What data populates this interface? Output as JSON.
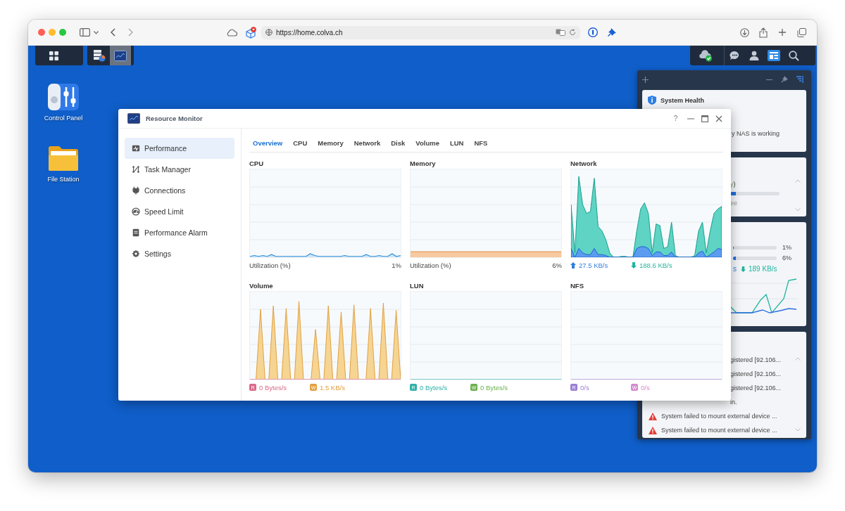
{
  "browser": {
    "url": "https://home.colva.ch"
  },
  "taskbar": {
    "apps": [
      {
        "selected": false
      },
      {
        "selected": true
      }
    ]
  },
  "desktop_icons": [
    {
      "label": "Control Panel"
    },
    {
      "label": "File Station"
    }
  ],
  "window": {
    "title": "Resource Monitor",
    "help": "?"
  },
  "sidebar": {
    "items": [
      {
        "label": "Performance",
        "selected": true
      },
      {
        "label": "Task Manager",
        "selected": false
      },
      {
        "label": "Connections",
        "selected": false
      },
      {
        "label": "Speed Limit",
        "selected": false
      },
      {
        "label": "Performance Alarm",
        "selected": false
      },
      {
        "label": "Settings",
        "selected": false
      }
    ]
  },
  "tabs": [
    {
      "label": "Overview",
      "selected": true
    },
    {
      "label": "CPU",
      "selected": false
    },
    {
      "label": "Memory",
      "selected": false
    },
    {
      "label": "Network",
      "selected": false
    },
    {
      "label": "Disk",
      "selected": false
    },
    {
      "label": "Volume",
      "selected": false
    },
    {
      "label": "LUN",
      "selected": false
    },
    {
      "label": "NFS",
      "selected": false
    }
  ],
  "charts": [
    {
      "title": "CPU",
      "kind": "utilization",
      "label": "Utilization  (%)",
      "value": "1%"
    },
    {
      "title": "Memory",
      "kind": "utilization",
      "label": "Utilization  (%)",
      "value": "6%"
    },
    {
      "title": "Network",
      "kind": "rates",
      "legend": [
        {
          "kind": "upload",
          "text": "27.5 KB/s",
          "color": "#2f7fe0"
        },
        {
          "kind": "download",
          "text": "188.6 KB/s",
          "color": "#1fb5a0"
        }
      ]
    },
    {
      "title": "Volume",
      "kind": "rates",
      "legend": [
        {
          "kind": "badge",
          "badge": "R",
          "text": "0 Bytes/s",
          "color": "#d9698a"
        },
        {
          "kind": "badge",
          "badge": "W",
          "text": "1.5 KB/s",
          "color": "#e0a040"
        }
      ]
    },
    {
      "title": "LUN",
      "kind": "rates",
      "legend": [
        {
          "kind": "badge",
          "badge": "R",
          "text": "0 Bytes/s",
          "color": "#2fb0a8"
        },
        {
          "kind": "badge",
          "badge": "W",
          "text": "0 Bytes/s",
          "color": "#6ab04c"
        }
      ]
    },
    {
      "title": "NFS",
      "kind": "rates",
      "legend": [
        {
          "kind": "badge",
          "badge": "R",
          "text": "0/s",
          "color": "#9b7fd6"
        },
        {
          "kind": "badge",
          "badge": "W",
          "text": "0/s",
          "color": "#d58bd0"
        }
      ]
    }
  ],
  "widgets": {
    "health": {
      "title": "System Health",
      "text": "y NAS is working"
    },
    "storage": {
      "status": "y",
      "status_rest": ")",
      "level": 0.12,
      "note": "ee"
    },
    "resources": {
      "rows": [
        {
          "value": "1%",
          "level": 0.01
        },
        {
          "value": "6%",
          "level": 0.06
        }
      ],
      "legend": [
        {
          "kind": "plain",
          "text": "s"
        },
        {
          "kind": "download",
          "text": "189 KB/s",
          "color": "#1fb5a0"
        }
      ]
    },
    "log": {
      "entries": [
        {
          "text": "gistered [92.106...",
          "warning": false
        },
        {
          "text": "gistered [92.106...",
          "warning": false
        },
        {
          "text": "gistered [92.106...",
          "warning": false
        },
        {
          "text": "in.",
          "warning": false
        },
        {
          "text": "System failed to mount external device ...",
          "warning": true
        },
        {
          "text": "System failed to mount external device ...",
          "warning": true
        }
      ]
    }
  }
}
